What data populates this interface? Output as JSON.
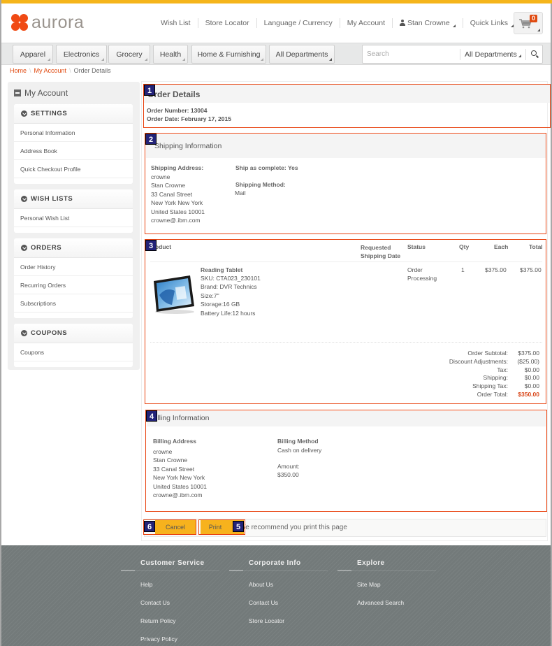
{
  "brand": {
    "name": "aurora",
    "accent": "#f04a14",
    "top_bar": "#f5b51b"
  },
  "header": {
    "links": [
      "Wish List",
      "Store Locator",
      "Language / Currency",
      "My Account"
    ],
    "user_name": "Stan Crowne",
    "quick_links": "Quick Links",
    "cart_count": "0"
  },
  "nav": {
    "departments": [
      "Apparel",
      "Electronics",
      "Grocery",
      "Health",
      "Home & Furnishing",
      "All Departments"
    ],
    "search_placeholder": "Search",
    "search_scope": "All Departments"
  },
  "breadcrumb": {
    "home": "Home",
    "account": "My Account",
    "current": "Order Details"
  },
  "sidebar": {
    "title": "My Account",
    "groups": [
      {
        "label": "SETTINGS",
        "items": [
          "Personal Information",
          "Address Book",
          "Quick Checkout Profile"
        ]
      },
      {
        "label": "WISH LISTS",
        "items": [
          "Personal Wish List"
        ]
      },
      {
        "label": "ORDERS",
        "items": [
          "Order History",
          "Recurring Orders",
          "Subscriptions"
        ]
      },
      {
        "label": "COUPONS",
        "items": [
          "Coupons"
        ]
      }
    ]
  },
  "order": {
    "title": "Order Details",
    "number_label": "Order Number:",
    "number": "13004",
    "date_label": "Order Date:",
    "date": "February 17, 2015"
  },
  "shipping": {
    "title": "Shipping Information",
    "address_label": "Shipping Address:",
    "address_lines": [
      "crowne",
      "Stan Crowne",
      "33 Canal Street",
      "New York New York",
      "United States 10001",
      "crowne@.ibm.com"
    ],
    "complete_label": "Ship as complete:",
    "complete_value": "Yes",
    "method_label": "Shipping Method:",
    "method_value": "Mail"
  },
  "products": {
    "columns": {
      "product": "Product",
      "req_date_1": "Requested",
      "req_date_2": "Shipping Date",
      "status": "Status",
      "qty": "Qty",
      "each": "Each",
      "total": "Total"
    },
    "items": [
      {
        "name": "Reading Tablet",
        "details": [
          "SKU: CTA023_230101",
          "Brand: DVR Technics",
          "Size:7\"",
          "Storage:16 GB",
          "Battery Life:12 hours"
        ],
        "status_1": "Order",
        "status_2": "Processing",
        "qty": "1",
        "each": "$375.00",
        "total": "$375.00"
      }
    ],
    "summary": [
      {
        "label": "Order Subtotal:",
        "value": "$375.00"
      },
      {
        "label": "Discount Adjustments:",
        "value": "($25.00)"
      },
      {
        "label": "Tax:",
        "value": "$0.00"
      },
      {
        "label": "Shipping:",
        "value": "$0.00"
      },
      {
        "label": "Shipping Tax:",
        "value": "$0.00"
      },
      {
        "label": "Order Total:",
        "value": "$350.00"
      }
    ],
    "total_color": "#d9471a"
  },
  "billing": {
    "title": "Billing Information",
    "address_label": "Billing Address",
    "address_lines": [
      "crowne",
      "Stan Crowne",
      "33 Canal Street",
      "New York New York",
      "United States 10001",
      "crowne@.ibm.com"
    ],
    "method_label": "Billing Method",
    "method_value": "Cash on delivery",
    "amount_label": "Amount:",
    "amount_value": "$350.00"
  },
  "actions": {
    "cancel": "Cancel",
    "print": "Print",
    "note": "We recommend you print this page"
  },
  "annotations": [
    "1",
    "2",
    "3",
    "4",
    "5",
    "6"
  ],
  "footer": {
    "columns": [
      {
        "title": "Customer Service",
        "links": [
          "Help",
          "Contact Us",
          "Return Policy",
          "Privacy Policy"
        ]
      },
      {
        "title": "Corporate Info",
        "links": [
          "About Us",
          "Contact Us",
          "Store Locator"
        ]
      },
      {
        "title": "Explore",
        "links": [
          "Site Map",
          "Advanced Search"
        ]
      }
    ]
  }
}
